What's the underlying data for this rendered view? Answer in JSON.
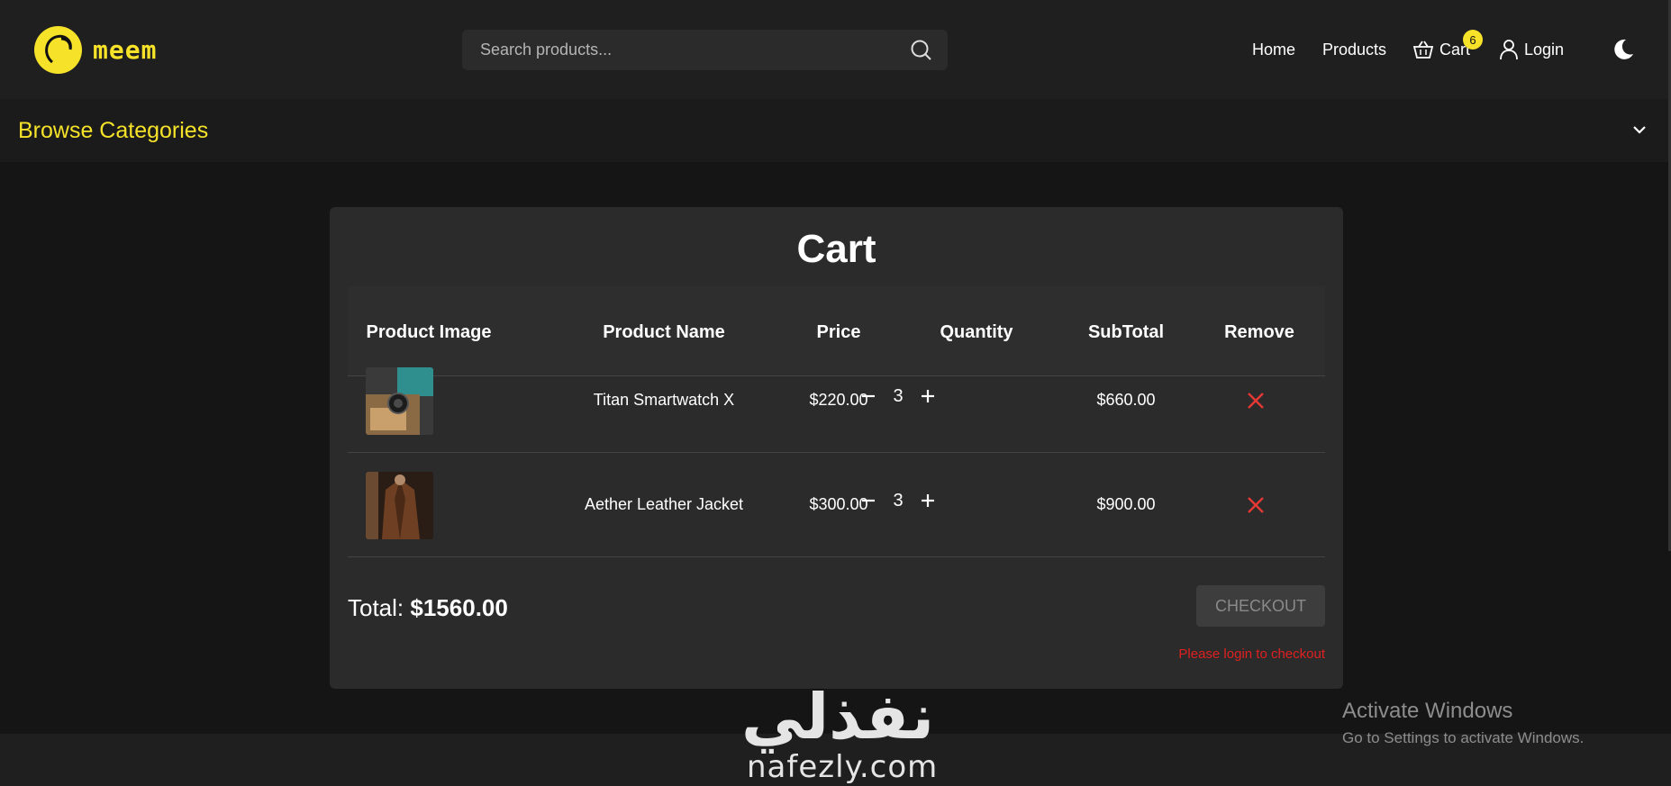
{
  "brand": {
    "name": "meem",
    "accent": "#f5e229"
  },
  "search": {
    "placeholder": "Search products..."
  },
  "nav": {
    "home": "Home",
    "products": "Products",
    "cart": "Cart",
    "cart_count": "6",
    "login": "Login"
  },
  "categories": {
    "title": "Browse Categories"
  },
  "cart": {
    "title": "Cart",
    "columns": [
      "Product Image",
      "Product Name",
      "Price",
      "Quantity",
      "SubTotal",
      "Remove"
    ],
    "items": [
      {
        "name": "Titan Smartwatch X",
        "price": "$220.00",
        "quantity": "3",
        "subtotal": "$660.00"
      },
      {
        "name": "Aether Leather Jacket",
        "price": "$300.00",
        "quantity": "3",
        "subtotal": "$900.00"
      }
    ],
    "total_label": "Total:",
    "total_value": "$1560.00",
    "checkout_label": "CHECKOUT",
    "login_message": "Please login to checkout"
  },
  "watermark": {
    "arabic": "نفذلي",
    "latin": "nafezly.com"
  },
  "os_notice": {
    "title": "Activate Windows",
    "subtitle": "Go to Settings to activate Windows."
  }
}
